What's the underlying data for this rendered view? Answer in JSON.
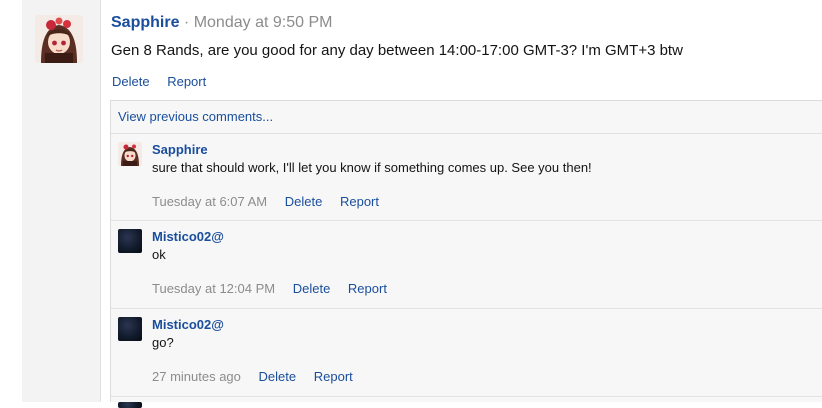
{
  "post": {
    "author": "Sapphire",
    "separator": "·",
    "time": "Monday at 9:50 PM",
    "body": "Gen 8 Rands, are you good for any day between 14:00-17:00 GMT-3? I'm GMT+3 btw",
    "actions": {
      "delete": "Delete",
      "report": "Report"
    }
  },
  "comments": {
    "view_previous": "View previous comments...",
    "items": [
      {
        "author": "Sapphire",
        "text": "sure that should work, I'll let you know if something comes up. See you then!",
        "time": "Tuesday at 6:07 AM",
        "delete": "Delete",
        "report": "Report",
        "avatar": "anime-girl-avatar"
      },
      {
        "author": "Mistico02@",
        "text": "ok",
        "time": "Tuesday at 12:04 PM",
        "delete": "Delete",
        "report": "Report",
        "avatar": "dark-space-avatar"
      },
      {
        "author": "Mistico02@",
        "text": "go?",
        "time": "27 minutes ago",
        "delete": "Delete",
        "report": "Report",
        "avatar": "dark-space-avatar"
      }
    ]
  },
  "colors": {
    "link": "#1a4e9c",
    "muted": "#8c8c8c",
    "comment_bg": "#f7f7f7",
    "gutter_bg": "#f3f3f3"
  }
}
